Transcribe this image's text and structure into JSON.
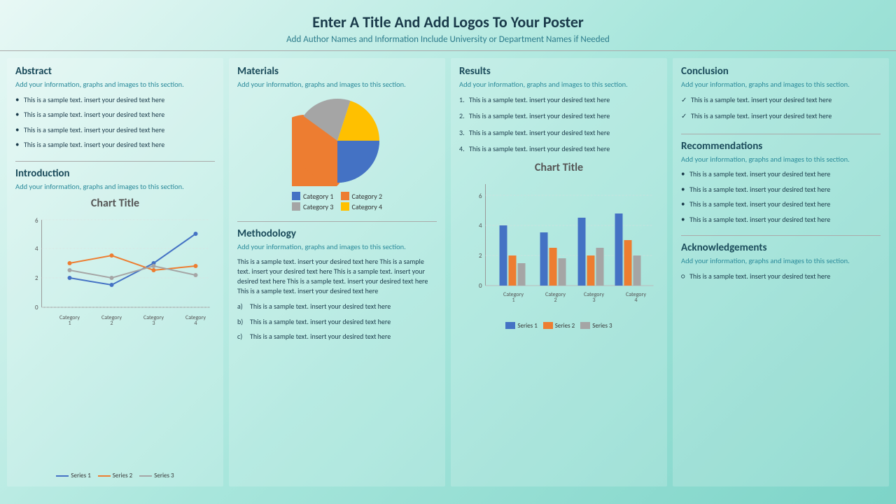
{
  "header": {
    "title": "Enter A Title And Add Logos To Your Poster",
    "subtitle": "Add Author Names and Information Include University or Department Names if Needed"
  },
  "abstract": {
    "title": "Abstract",
    "subtitle": "Add your information, graphs and images to this section.",
    "items": [
      "This is a sample text. insert your desired text here",
      "This is a sample text. insert your desired text here",
      "This is a sample text. insert your desired text here",
      "This is a sample text. insert your desired text here"
    ]
  },
  "introduction": {
    "title": "Introduction",
    "subtitle": "Add your information, graphs and images to this section.",
    "chart_title": "Chart Title",
    "categories": [
      "Category 1",
      "Category 2",
      "Category 3",
      "Category 4"
    ],
    "series": [
      {
        "name": "Series 1",
        "color": "#4472C4"
      },
      {
        "name": "Series 2",
        "color": "#ED7D31"
      },
      {
        "name": "Series 3",
        "color": "#A5A5A5"
      }
    ],
    "line_data": {
      "s1": [
        2,
        1.5,
        3,
        5
      ],
      "s2": [
        3,
        3.5,
        2.5,
        2.8
      ],
      "s3": [
        2.5,
        2,
        2.8,
        2.2
      ]
    },
    "y_labels": [
      0,
      2,
      4,
      6
    ]
  },
  "materials": {
    "title": "Materials",
    "subtitle": "Add your information, graphs and images to this section.",
    "pie_categories": [
      "Category 1",
      "Category 2",
      "Category 3",
      "Category 4"
    ],
    "pie_colors": [
      "#4472C4",
      "#ED7D31",
      "#A5A5A5",
      "#FFC000"
    ],
    "pie_values": [
      25,
      35,
      20,
      20
    ]
  },
  "methodology": {
    "title": "Methodology",
    "subtitle": "Add your information, graphs and images to this section.",
    "body_text": "This is a sample text. insert your desired text here This is a sample text. insert your desired text here This is a sample text. insert your desired text here This is a sample text. insert your desired text here This is a sample text. insert your desired text here",
    "items": [
      "This is a sample text. insert your desired text here",
      "This is a sample text. insert your desired text here",
      "This is a sample text. insert your desired text here"
    ]
  },
  "results": {
    "title": "Results",
    "subtitle": "Add your information, graphs and images to this section.",
    "items": [
      "This is a sample text. insert your desired text here",
      "This is a sample text. insert your desired text here",
      "This is a sample text. insert your desired text here",
      "This is a sample text. insert your desired text here"
    ],
    "chart_title": "Chart Title",
    "categories": [
      "Category 1",
      "Category 2",
      "Category 3",
      "Category 4"
    ],
    "series": [
      {
        "name": "Series 1",
        "color": "#4472C4"
      },
      {
        "name": "Series 2",
        "color": "#ED7D31"
      },
      {
        "name": "Series 3",
        "color": "#A5A5A5"
      }
    ],
    "bar_data": {
      "s1": [
        4,
        3.5,
        4.5,
        4.8
      ],
      "s2": [
        2,
        2.5,
        2,
        3
      ],
      "s3": [
        1.5,
        1.8,
        2.5,
        2
      ]
    },
    "y_labels": [
      0,
      2,
      4,
      6
    ]
  },
  "conclusion": {
    "title": "Conclusion",
    "subtitle": "Add your information, graphs and images to this section.",
    "items": [
      "This is a sample text. insert your desired text here",
      "This is a sample text. insert your desired text here"
    ]
  },
  "recommendations": {
    "title": "Recommendations",
    "subtitle": "Add your information, graphs and images to this section.",
    "items": [
      "This is a sample text. insert your desired text here",
      "This is a sample text. insert your desired text here",
      "This is a sample text. insert your desired text here",
      "This is a sample text. insert your desired text here"
    ]
  },
  "acknowledgements": {
    "title": "Acknowledgements",
    "subtitle": "Add your information, graphs and images to this section.",
    "items": [
      "This is a sample text. insert your desired text here"
    ]
  }
}
